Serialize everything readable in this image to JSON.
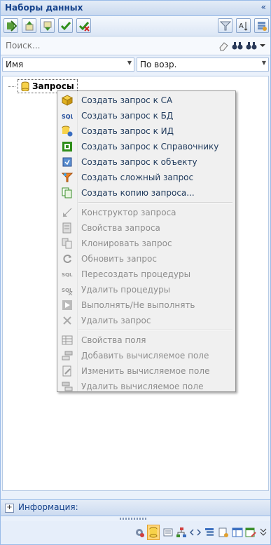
{
  "panel": {
    "title": "Наборы данных",
    "collapse_glyph": "«"
  },
  "toolbar": {
    "left_icons": [
      "add-dataset-icon",
      "move-up-icon",
      "move-down-icon",
      "check-icon",
      "uncheck-icon"
    ],
    "right_icons": [
      "filter-icon",
      "sort-alpha-icon",
      "dataset-settings-icon"
    ]
  },
  "search": {
    "placeholder": "Поиск...",
    "value": ""
  },
  "sort": {
    "field": "Имя",
    "order": "По возр."
  },
  "tree": {
    "root_label": "Запросы"
  },
  "context_menu": {
    "groups": [
      [
        {
          "label": "Создать запрос к СА",
          "icon": "cube-icon",
          "enabled": true
        },
        {
          "label": "Создать запрос к БД",
          "icon": "sql-icon",
          "enabled": true
        },
        {
          "label": "Создать запрос к ИД",
          "icon": "db-info-icon",
          "enabled": true
        },
        {
          "label": "Создать запрос к Справочнику",
          "icon": "reference-book-icon",
          "enabled": true
        },
        {
          "label": "Создать запрос к объекту",
          "icon": "object-icon",
          "enabled": true
        },
        {
          "label": "Создать сложный запрос",
          "icon": "complex-query-icon",
          "enabled": true
        },
        {
          "label": "Создать копию запроса...",
          "icon": "copy-query-icon",
          "enabled": true
        }
      ],
      [
        {
          "label": "Конструктор запроса",
          "icon": "designer-icon",
          "enabled": false
        },
        {
          "label": "Свойства запроса",
          "icon": "properties-icon",
          "enabled": false
        },
        {
          "label": "Клонировать запрос",
          "icon": "clone-icon",
          "enabled": false
        },
        {
          "label": "Обновить запрос",
          "icon": "refresh-icon",
          "enabled": false
        },
        {
          "label": "Пересоздать процедуры",
          "icon": "sql-recreate-icon",
          "enabled": false
        },
        {
          "label": "Удалить процедуры",
          "icon": "sql-delete-icon",
          "enabled": false
        },
        {
          "label": "Выполнять/Не выполнять",
          "icon": "play-icon",
          "enabled": false
        },
        {
          "label": "Удалить запрос",
          "icon": "delete-icon",
          "enabled": false
        }
      ],
      [
        {
          "label": "Свойства поля",
          "icon": "field-properties-icon",
          "enabled": false
        },
        {
          "label": "Добавить вычисляемое поле",
          "icon": "add-field-icon",
          "enabled": false
        },
        {
          "label": "Изменить вычисляемое поле",
          "icon": "edit-field-icon",
          "enabled": false
        },
        {
          "label": "Удалить вычисляемое поле",
          "icon": "remove-field-icon",
          "enabled": false
        }
      ]
    ]
  },
  "info": {
    "expander": "+",
    "label": "Информация:"
  },
  "bottom_bar": {
    "icons": [
      "gear-settings-icon",
      "datasets-icon",
      "list-icon",
      "tree-structure-icon",
      "code-icon",
      "tree-list-icon",
      "report-icon",
      "table-icon",
      "table-edit-icon",
      "overflow-chevron-icon"
    ],
    "active_index": 1
  },
  "colors": {
    "accent": "#15428b",
    "border": "#99bbe8",
    "menu_text": "#1e395b",
    "menu_disabled": "#8d8d8d"
  }
}
